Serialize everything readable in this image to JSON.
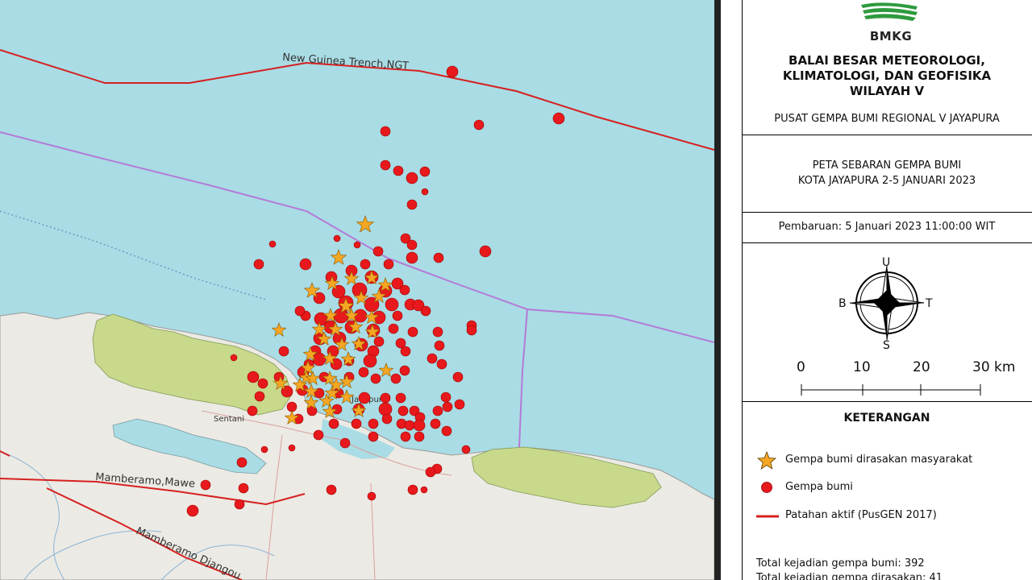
{
  "colors": {
    "sea": "#a9dce4",
    "land": "#eceae4",
    "hills": "#c9d98c",
    "fault": "#d62020",
    "boundary": "#b47ad8",
    "quake": "#e8191c",
    "felt": "#f5a623"
  },
  "map": {
    "labels": {
      "trench": "New Guinea Trench,NGT",
      "fault_1": "Mamberamo,Mawe",
      "fault_2": "Mamberamo Djangou",
      "city_sentani": "Sentani",
      "city_jayapura": "Jayapura"
    },
    "quakes": [
      [
        561,
        89,
        7
      ],
      [
        594,
        155,
        6
      ],
      [
        693,
        147,
        7
      ],
      [
        478,
        163,
        6
      ],
      [
        478,
        205,
        6
      ],
      [
        494,
        212,
        6
      ],
      [
        511,
        221,
        7
      ],
      [
        527,
        213,
        6
      ],
      [
        527,
        238,
        4
      ],
      [
        511,
        254,
        6
      ],
      [
        503,
        296,
        6
      ],
      [
        511,
        304,
        6
      ],
      [
        544,
        320,
        6
      ],
      [
        602,
        312,
        7
      ],
      [
        511,
        320,
        7
      ],
      [
        338,
        303,
        4
      ],
      [
        321,
        328,
        6
      ],
      [
        379,
        328,
        7
      ],
      [
        418,
        296,
        4
      ],
      [
        443,
        304,
        4
      ],
      [
        469,
        312,
        6
      ],
      [
        482,
        328,
        6
      ],
      [
        453,
        328,
        6
      ],
      [
        436,
        336,
        7
      ],
      [
        411,
        344,
        7
      ],
      [
        461,
        344,
        8
      ],
      [
        493,
        352,
        7
      ],
      [
        502,
        360,
        6
      ],
      [
        478,
        361,
        8
      ],
      [
        446,
        360,
        9
      ],
      [
        420,
        362,
        8
      ],
      [
        396,
        370,
        7
      ],
      [
        429,
        376,
        9
      ],
      [
        461,
        378,
        9
      ],
      [
        486,
        378,
        8
      ],
      [
        509,
        378,
        7
      ],
      [
        519,
        379,
        7
      ],
      [
        528,
        386,
        6
      ],
      [
        493,
        392,
        6
      ],
      [
        470,
        394,
        8
      ],
      [
        447,
        392,
        8
      ],
      [
        423,
        392,
        9
      ],
      [
        398,
        396,
        8
      ],
      [
        379,
        392,
        6
      ],
      [
        372,
        386,
        6
      ],
      [
        410,
        406,
        8
      ],
      [
        436,
        406,
        8
      ],
      [
        463,
        410,
        8
      ],
      [
        488,
        408,
        6
      ],
      [
        512,
        412,
        6
      ],
      [
        543,
        412,
        6
      ],
      [
        585,
        404,
        6
      ],
      [
        585,
        410,
        6
      ],
      [
        397,
        420,
        8
      ],
      [
        421,
        420,
        8
      ],
      [
        448,
        428,
        8
      ],
      [
        470,
        424,
        6
      ],
      [
        497,
        426,
        6
      ],
      [
        503,
        436,
        6
      ],
      [
        545,
        429,
        6
      ],
      [
        391,
        436,
        7
      ],
      [
        413,
        436,
        7
      ],
      [
        352,
        436,
        6
      ],
      [
        463,
        436,
        7
      ],
      [
        536,
        445,
        6
      ],
      [
        396,
        446,
        8
      ],
      [
        433,
        448,
        6
      ],
      [
        459,
        448,
        8
      ],
      [
        383,
        452,
        6
      ],
      [
        417,
        452,
        7
      ],
      [
        376,
        462,
        7
      ],
      [
        451,
        462,
        6
      ],
      [
        548,
        452,
        6
      ],
      [
        290,
        444,
        4
      ],
      [
        502,
        460,
        6
      ],
      [
        568,
        468,
        6
      ],
      [
        314,
        468,
        7
      ],
      [
        346,
        468,
        6
      ],
      [
        402,
        468,
        6
      ],
      [
        433,
        468,
        6
      ],
      [
        466,
        470,
        6
      ],
      [
        491,
        470,
        6
      ],
      [
        326,
        476,
        6
      ],
      [
        356,
        486,
        7
      ],
      [
        375,
        484,
        7
      ],
      [
        396,
        488,
        6
      ],
      [
        420,
        488,
        6
      ],
      [
        452,
        494,
        7
      ],
      [
        478,
        494,
        6
      ],
      [
        497,
        494,
        6
      ],
      [
        553,
        493,
        6
      ],
      [
        570,
        502,
        6
      ],
      [
        322,
        492,
        6
      ],
      [
        313,
        510,
        6
      ],
      [
        362,
        505,
        6
      ],
      [
        387,
        510,
        6
      ],
      [
        418,
        508,
        6
      ],
      [
        445,
        508,
        7
      ],
      [
        478,
        508,
        8
      ],
      [
        500,
        510,
        6
      ],
      [
        514,
        510,
        6
      ],
      [
        521,
        518,
        6
      ],
      [
        543,
        510,
        6
      ],
      [
        555,
        505,
        6
      ],
      [
        442,
        526,
        6
      ],
      [
        463,
        526,
        6
      ],
      [
        480,
        520,
        6
      ],
      [
        498,
        526,
        6
      ],
      [
        508,
        528,
        6
      ],
      [
        520,
        528,
        7
      ],
      [
        540,
        526,
        6
      ],
      [
        554,
        535,
        6
      ],
      [
        370,
        520,
        6
      ],
      [
        414,
        526,
        6
      ],
      [
        463,
        542,
        6
      ],
      [
        503,
        542,
        6
      ],
      [
        520,
        542,
        6
      ],
      [
        395,
        540,
        6
      ],
      [
        428,
        550,
        6
      ],
      [
        578,
        558,
        5
      ],
      [
        300,
        574,
        6
      ],
      [
        328,
        558,
        4
      ],
      [
        362,
        556,
        4
      ],
      [
        542,
        582,
        6
      ],
      [
        534,
        586,
        6
      ],
      [
        512,
        608,
        6
      ],
      [
        526,
        608,
        4
      ],
      [
        255,
        602,
        6
      ],
      [
        302,
        606,
        6
      ],
      [
        411,
        608,
        6
      ],
      [
        461,
        616,
        5
      ],
      [
        297,
        626,
        6
      ],
      [
        239,
        634,
        7
      ]
    ],
    "felt_quakes": [
      [
        453,
        279,
        11
      ],
      [
        420,
        320,
        10
      ],
      [
        387,
        361,
        10
      ],
      [
        412,
        352,
        9
      ],
      [
        436,
        346,
        9
      ],
      [
        461,
        345,
        9
      ],
      [
        478,
        354,
        9
      ],
      [
        429,
        380,
        10
      ],
      [
        448,
        370,
        9
      ],
      [
        470,
        368,
        9
      ],
      [
        410,
        392,
        9
      ],
      [
        436,
        392,
        9
      ],
      [
        461,
        394,
        9
      ],
      [
        396,
        409,
        9
      ],
      [
        416,
        409,
        9
      ],
      [
        441,
        406,
        9
      ],
      [
        462,
        412,
        9
      ],
      [
        346,
        410,
        9
      ],
      [
        402,
        421,
        9
      ],
      [
        424,
        428,
        9
      ],
      [
        445,
        427,
        9
      ],
      [
        385,
        440,
        9
      ],
      [
        409,
        445,
        9
      ],
      [
        432,
        446,
        9
      ],
      [
        382,
        457,
        9
      ],
      [
        479,
        460,
        9
      ],
      [
        380,
        469,
        9
      ],
      [
        409,
        470,
        9
      ],
      [
        430,
        474,
        9
      ],
      [
        386,
        486,
        9
      ],
      [
        412,
        488,
        9
      ],
      [
        430,
        493,
        9
      ],
      [
        386,
        500,
        9
      ],
      [
        405,
        498,
        9
      ],
      [
        362,
        519,
        9
      ],
      [
        409,
        511,
        9
      ],
      [
        445,
        510,
        9
      ],
      [
        348,
        476,
        9
      ],
      [
        372,
        478,
        9
      ],
      [
        417,
        478,
        9
      ],
      [
        388,
        470,
        9
      ]
    ]
  },
  "panel": {
    "logo_text": "BMKG",
    "org_line1": "BALAI BESAR METEOROLOGI,",
    "org_line2": "KLIMATOLOGI, DAN GEOFISIKA",
    "org_line3": "WILAYAH V",
    "center_name": "PUSAT GEMPA BUMI REGIONAL V JAYAPURA",
    "map_title_1": "PETA SEBARAN GEMPA BUMI",
    "map_title_2": "KOTA JAYAPURA 2-5 JANUARI 2023",
    "update_text": "Pembaruan: 5 Januari 2023  11:00:00 WIT",
    "compass": {
      "north": "U",
      "south": "S",
      "east": "T",
      "west": "B"
    },
    "scale": {
      "labels": [
        "0",
        "10",
        "20",
        "30 km"
      ]
    },
    "legend": {
      "title": "KETERANGAN",
      "felt": "Gempa bumi dirasakan masyarakat",
      "quake": "Gempa bumi",
      "fault": "Patahan aktif (PusGEN 2017)"
    },
    "totals": {
      "line1": "Total kejadian gempa bumi: 392",
      "line2": "Total kejadian gempa dirasakan: 41"
    }
  }
}
